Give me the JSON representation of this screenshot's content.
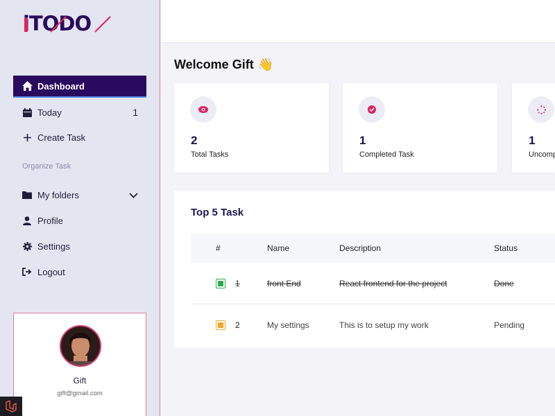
{
  "app": {
    "logo_text": "iTODO"
  },
  "sidebar": {
    "items": [
      {
        "label": "Dashboard",
        "icon": "home-icon",
        "active": true
      },
      {
        "label": "Today",
        "icon": "calendar-icon",
        "count": "1"
      },
      {
        "label": "Create Task",
        "icon": "plus-icon"
      },
      {
        "label": "My folders",
        "icon": "folder-icon"
      },
      {
        "label": "Profile",
        "icon": "user-icon"
      },
      {
        "label": "Settings",
        "icon": "gear-icon"
      },
      {
        "label": "Logout",
        "icon": "logout-icon"
      }
    ],
    "section_label": "Organize Task"
  },
  "profile": {
    "name": "Gift",
    "email": "gift@gmail.com"
  },
  "main": {
    "welcome": "Welcome Gift",
    "welcome_emoji": "👋",
    "stats": [
      {
        "value": "2",
        "label": "Total Tasks",
        "icon": "eye-icon"
      },
      {
        "value": "1",
        "label": "Completed Task",
        "icon": "check-circle-icon"
      },
      {
        "value": "1",
        "label": "Uncomp",
        "icon": "spinner-icon"
      }
    ],
    "tasks_panel": {
      "title": "Top 5 Task",
      "columns": [
        "#",
        "Name",
        "Description",
        "Status"
      ],
      "rows": [
        {
          "num": "1",
          "name": "front End",
          "description": "React frontend for the project",
          "status": "Done",
          "done": true
        },
        {
          "num": "2",
          "name": "My settings",
          "description": "This is to setup my work",
          "status": "Pending",
          "done": false
        }
      ]
    }
  },
  "colors": {
    "primary": "#2a0a5e",
    "accent": "#e0245e",
    "done_check": "#2eaa4a",
    "pending_check": "#f5a623"
  }
}
